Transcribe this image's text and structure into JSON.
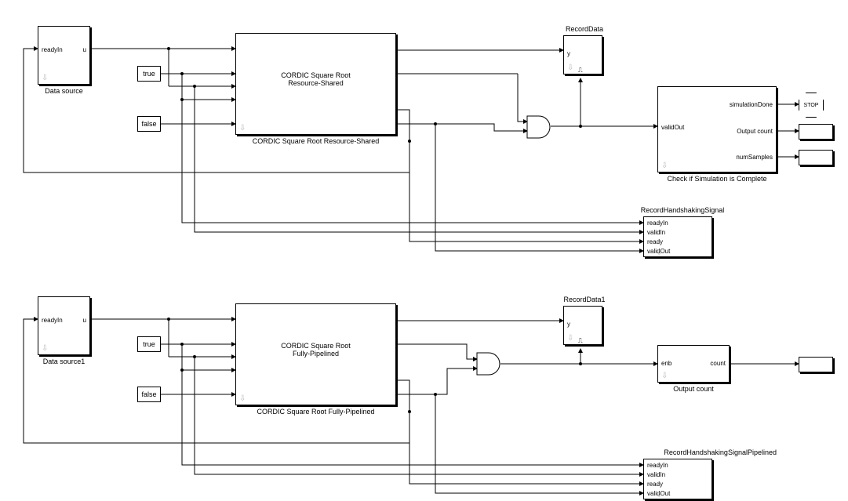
{
  "top": {
    "data_source": {
      "label": "Data source",
      "in": "readyIn",
      "out": "u"
    },
    "const_true": "true",
    "const_false": "false",
    "cordic": {
      "title1": "CORDIC Square Root",
      "title2": "Resource-Shared",
      "label": "CORDIC Square Root Resource-Shared"
    },
    "record_data": {
      "label": "RecordData",
      "port": "y"
    },
    "and_gate": "AND",
    "check_sim": {
      "label": "Check if Simulation is Complete",
      "in": "validOut",
      "out1": "simulationDone",
      "out2": "Output count",
      "out3": "numSamples"
    },
    "stop": "STOP",
    "hand": {
      "label": "RecordHandshakingSignal",
      "p1": "readyIn",
      "p2": "validIn",
      "p3": "ready",
      "p4": "validOut"
    }
  },
  "bot": {
    "data_source": {
      "label": "Data source1",
      "in": "readyIn",
      "out": "u"
    },
    "const_true": "true",
    "const_false": "false",
    "cordic": {
      "title1": "CORDIC Square Root",
      "title2": "Fully-Pipelined",
      "label": "CORDIC Square Root Fully-Pipelined"
    },
    "record_data": {
      "label": "RecordData1",
      "port": "y"
    },
    "and_gate": "AND",
    "out_count": {
      "label": "Output count",
      "in": "enb",
      "out": "count"
    },
    "hand": {
      "label": "RecordHandshakingSignalPipelined",
      "p1": "readyIn",
      "p2": "validIn",
      "p3": "ready",
      "p4": "validOut"
    }
  }
}
